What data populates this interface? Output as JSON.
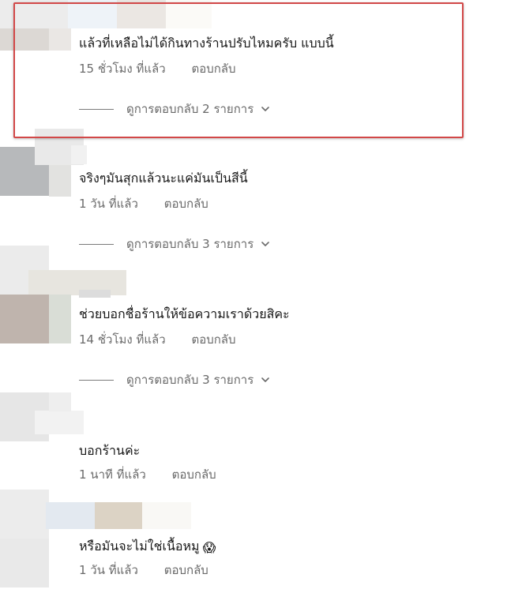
{
  "comments": [
    {
      "text": "แล้วที่เหลือไม่ได้กินทางร้านปรับไหมครับ แบบนี้",
      "time": "15 ชั่วโมง ที่แล้ว",
      "reply": "ตอบกลับ",
      "view_replies": "ดูการตอบกลับ 2 รายการ"
    },
    {
      "text": "จริงๆมันสุกแล้วนะแค่มันเป็นสีนี้",
      "time": "1 วัน ที่แล้ว",
      "reply": "ตอบกลับ",
      "view_replies": "ดูการตอบกลับ 3 รายการ"
    },
    {
      "text": "ช่วยบอกชื่อร้านให้ข้อความเราด้วยสิคะ",
      "time": "14 ชั่วโมง ที่แล้ว",
      "reply": "ตอบกลับ",
      "view_replies": "ดูการตอบกลับ 3 รายการ"
    },
    {
      "text": "บอกร้านค่ะ",
      "time": "1 นาที ที่แล้ว",
      "reply": "ตอบกลับ"
    },
    {
      "text": "หรือมันจะไม่ใช่เนื้อหมู",
      "emoji": "😱",
      "time": "1 วัน ที่แล้ว",
      "reply": "ตอบกลับ"
    }
  ],
  "colors": {
    "highlight_border": "#d24848",
    "meta_text": "#6a6a6a",
    "comment_text": "#161616"
  }
}
